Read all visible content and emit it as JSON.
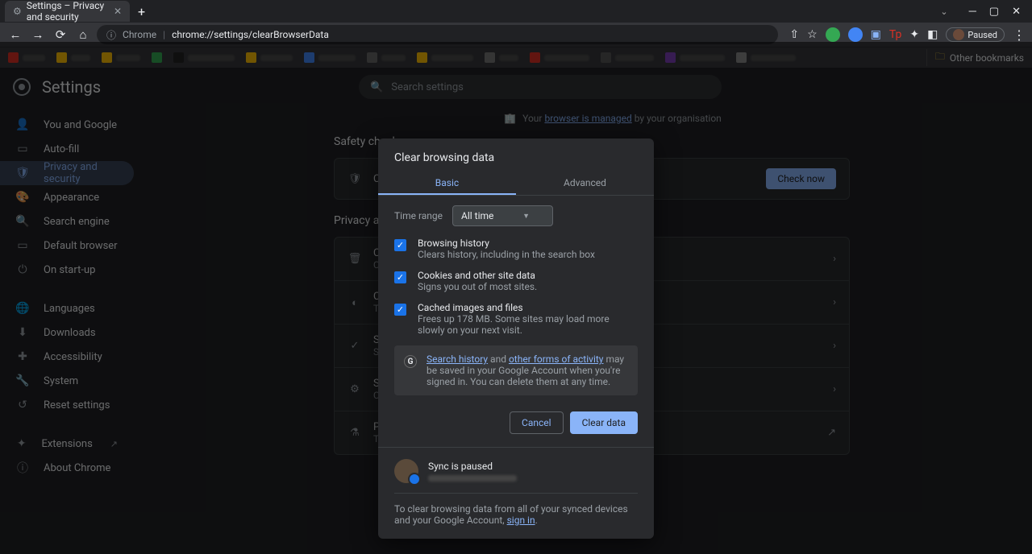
{
  "browser": {
    "tab_title": "Settings – Privacy and security",
    "omnibox_prefix": "Chrome",
    "omnibox_url": "chrome://settings/clearBrowserData",
    "paused_label": "Paused",
    "other_bookmarks": "Other bookmarks"
  },
  "settings_header": {
    "title": "Settings",
    "search_placeholder": "Search settings"
  },
  "sidebar": {
    "items": [
      {
        "label": "You and Google"
      },
      {
        "label": "Auto-fill"
      },
      {
        "label": "Privacy and security"
      },
      {
        "label": "Appearance"
      },
      {
        "label": "Search engine"
      },
      {
        "label": "Default browser"
      },
      {
        "label": "On start-up"
      }
    ],
    "advanced": [
      {
        "label": "Languages"
      },
      {
        "label": "Downloads"
      },
      {
        "label": "Accessibility"
      },
      {
        "label": "System"
      },
      {
        "label": "Reset settings"
      }
    ],
    "footer": [
      {
        "label": "Extensions"
      },
      {
        "label": "About Chrome"
      }
    ]
  },
  "managed_notice": {
    "prefix": "Your ",
    "link": "browser is managed",
    "suffix": " by your organisation"
  },
  "sections": {
    "safety_check": "Safety check",
    "privacy_security": "Privacy and s",
    "check_now": "Check now",
    "chrome_row": "Chro",
    "rows": [
      {
        "title": "Clear",
        "sub": "Clear"
      },
      {
        "title": "Cook",
        "sub": "Third"
      },
      {
        "title": "Secu",
        "sub": "Safe"
      },
      {
        "title": "Site s",
        "sub": "Cont"
      },
      {
        "title": "Priva",
        "sub": "Trial"
      }
    ]
  },
  "dialog": {
    "title": "Clear browsing data",
    "tabs": {
      "basic": "Basic",
      "advanced": "Advanced"
    },
    "time_range_label": "Time range",
    "time_range_value": "All time",
    "checks": [
      {
        "title": "Browsing history",
        "sub": "Clears history, including in the search box"
      },
      {
        "title": "Cookies and other site data",
        "sub": "Signs you out of most sites."
      },
      {
        "title": "Cached images and files",
        "sub": "Frees up 178 MB. Some sites may load more slowly on your next visit."
      }
    ],
    "info": {
      "link1": "Search history",
      "mid": " and ",
      "link2": "other forms of activity",
      "rest": " may be saved in your Google Account when you're signed in. You can delete them at any time."
    },
    "buttons": {
      "cancel": "Cancel",
      "clear": "Clear data"
    },
    "sync": {
      "title": "Sync is paused",
      "note_prefix": "To clear browsing data from all of your synced devices and your Google Account, ",
      "sign_in": "sign in",
      "note_suffix": "."
    }
  }
}
